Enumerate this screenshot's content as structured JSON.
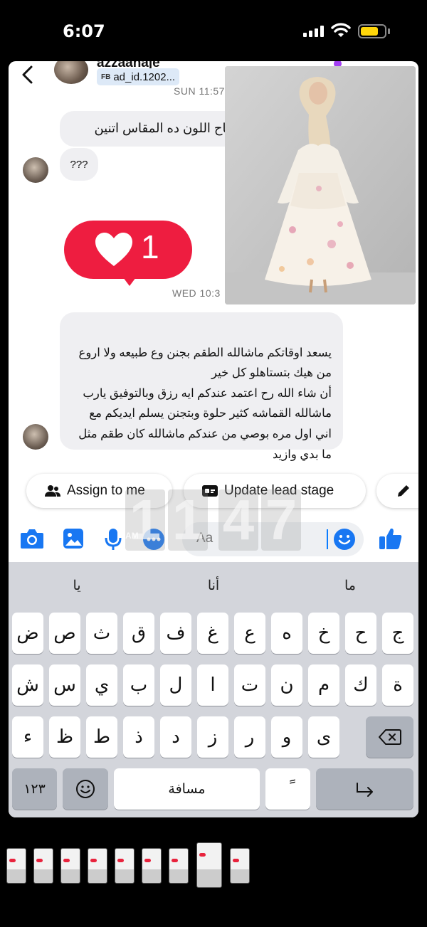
{
  "status_bar": {
    "time": "6:07"
  },
  "header": {
    "contact_name": "azzaanaje",
    "ad_tag_prefix": "FB",
    "ad_tag": "ad_id.1202..."
  },
  "thread": {
    "timestamp_top": "SUN 11:57",
    "timestamp_mid": "WED 10:3",
    "msg_top": "بكرا متاح اللون ده المقاس اتنين",
    "msg_small": "???",
    "msg_main": "يسعد اوقاتكم ماشالله الطقم بجنن وع طبيعه ولا اروع\nمن هيك بتستاهلو كل خير\nأن شاء الله رح اعتمد عندكم ايه رزق وبالتوفيق يارب\nماشالله القماشه كثير حلوة وبتجنن يسلم ايديكم مع\nاني اول مره بوصي من عندكم ماشالله كان طقم مثل\nما بدي وازيد",
    "reaction_count": "1"
  },
  "actions": {
    "assign_label": "Assign to me",
    "update_label": "Update lead stage"
  },
  "composer": {
    "placeholder": "Aa"
  },
  "keyboard": {
    "suggestions": [
      "يا",
      "أنا",
      "ما"
    ],
    "row1": [
      "ض",
      "ص",
      "ث",
      "ق",
      "ف",
      "غ",
      "ع",
      "ه",
      "خ",
      "ح",
      "ج"
    ],
    "row2": [
      "ش",
      "س",
      "ي",
      "ب",
      "ل",
      "ا",
      "ت",
      "ن",
      "م",
      "ك",
      "ة"
    ],
    "row3": [
      "ء",
      "ظ",
      "ط",
      "ذ",
      "د",
      "ز",
      "ر",
      "و",
      "ى"
    ],
    "numbers_label": "١٢٣",
    "space_label": "مسافة",
    "tanwin_label": "ً"
  },
  "clock_overlay": {
    "digits": [
      "1",
      "1",
      "4",
      "7"
    ],
    "ampm": "AM"
  },
  "colors": {
    "accent": "#1877f2",
    "reaction": "#ee1d40",
    "keyboard_bg": "#d3d5db",
    "bubble": "#efeff2"
  }
}
